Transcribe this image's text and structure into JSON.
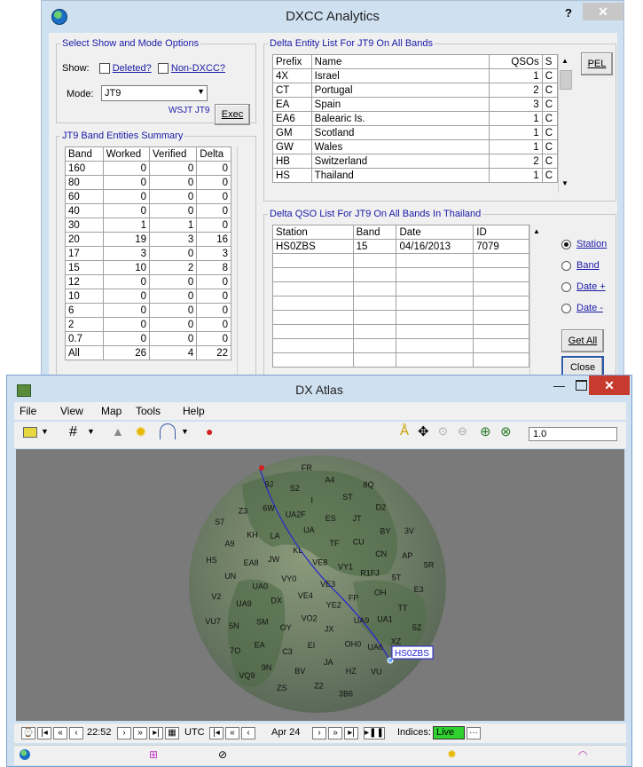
{
  "dxcc": {
    "title": "DXCC Analytics",
    "help_glyph": "?",
    "close_glyph": "✕",
    "options": {
      "legend": "Select Show and Mode Options",
      "show_label": "Show:",
      "deleted_label": "Deleted?",
      "non_dxcc_label": "Non-DXCC?",
      "mode_label": "Mode:",
      "mode_value": "JT9",
      "mode_sub": "WSJT JT9",
      "exec_label": "Exec"
    },
    "band_summary": {
      "legend": "JT9 Band Entities Summary",
      "headers": [
        "Band",
        "Worked",
        "Verified",
        "Delta"
      ],
      "rows": [
        [
          "160",
          "0",
          "0",
          "0"
        ],
        [
          "80",
          "0",
          "0",
          "0"
        ],
        [
          "60",
          "0",
          "0",
          "0"
        ],
        [
          "40",
          "0",
          "0",
          "0"
        ],
        [
          "30",
          "1",
          "1",
          "0"
        ],
        [
          "20",
          "19",
          "3",
          "16"
        ],
        [
          "17",
          "3",
          "0",
          "3"
        ],
        [
          "15",
          "10",
          "2",
          "8"
        ],
        [
          "12",
          "0",
          "0",
          "0"
        ],
        [
          "10",
          "0",
          "0",
          "0"
        ],
        [
          "6",
          "0",
          "0",
          "0"
        ],
        [
          "2",
          "0",
          "0",
          "0"
        ],
        [
          "0.7",
          "0",
          "0",
          "0"
        ],
        [
          "All",
          "26",
          "4",
          "22"
        ]
      ]
    },
    "entity_list": {
      "legend": "Delta Entity List For JT9 On All Bands",
      "headers": [
        "Prefix",
        "Name",
        "QSOs",
        "S"
      ],
      "rows": [
        [
          "4X",
          "Israel",
          "1",
          "C"
        ],
        [
          "CT",
          "Portugal",
          "2",
          "C"
        ],
        [
          "EA",
          "Spain",
          "3",
          "C"
        ],
        [
          "EA6",
          "Balearic Is.",
          "1",
          "C"
        ],
        [
          "GM",
          "Scotland",
          "1",
          "C"
        ],
        [
          "GW",
          "Wales",
          "1",
          "C"
        ],
        [
          "HB",
          "Switzerland",
          "2",
          "C"
        ],
        [
          "HS",
          "Thailand",
          "1",
          "C"
        ]
      ],
      "pel_label": "PEL"
    },
    "qso_list": {
      "legend": "Delta QSO List For JT9 On All Bands In Thailand",
      "headers": [
        "Station",
        "Band",
        "Date",
        "ID"
      ],
      "rows": [
        [
          "HS0ZBS",
          "15",
          "04/16/2013",
          "7079"
        ]
      ]
    },
    "sort": {
      "options": [
        "Station",
        "Band",
        "Date +",
        "Date -"
      ],
      "selected": "Station"
    },
    "get_all_label": "Get All",
    "close_label": "Close"
  },
  "atlas": {
    "title": "DX Atlas",
    "menu": [
      "File",
      "View",
      "Map",
      "Tools",
      "Help"
    ],
    "zoom_value": "1.0",
    "path_label": "HS0ZBS",
    "prefixes": [
      "VE3",
      "VE4",
      "VE8",
      "YE2",
      "VY0",
      "VY1",
      "VO2",
      "KL",
      "FP",
      "DX",
      "TF",
      "JX",
      "JW",
      "R1FJ",
      "OY",
      "UA",
      "UA9",
      "UA0",
      "CU",
      "EI",
      "LA",
      "OH",
      "SM",
      "ES",
      "OH0",
      "EA8",
      "CN",
      "C3",
      "UA2F",
      "UA1",
      "UA9",
      "JT",
      "JA",
      "KH",
      "5T",
      "EA",
      "I",
      "UA6",
      "UN",
      "BY",
      "BV",
      "6W",
      "TT",
      "5N",
      "ST",
      "HZ",
      "A9",
      "AP",
      "9N",
      "S2",
      "XZ",
      "V2",
      "D2",
      "Z2",
      "Z3",
      "E3",
      "7O",
      "A4",
      "VU",
      "HS",
      "3V",
      "ZS",
      "9J",
      "5Z",
      "VU7",
      "8Q",
      "3B6",
      "S7",
      "5R",
      "VQ9",
      "FR"
    ],
    "time_value": "22:52",
    "utc_label": "UTC",
    "date_value": "Apr 24",
    "indices_label": "Indices:",
    "indices_value": "Live",
    "colors": {
      "live": "#2fd12f",
      "path": "#2323d6",
      "map_bg": "#7a7a7a"
    }
  }
}
